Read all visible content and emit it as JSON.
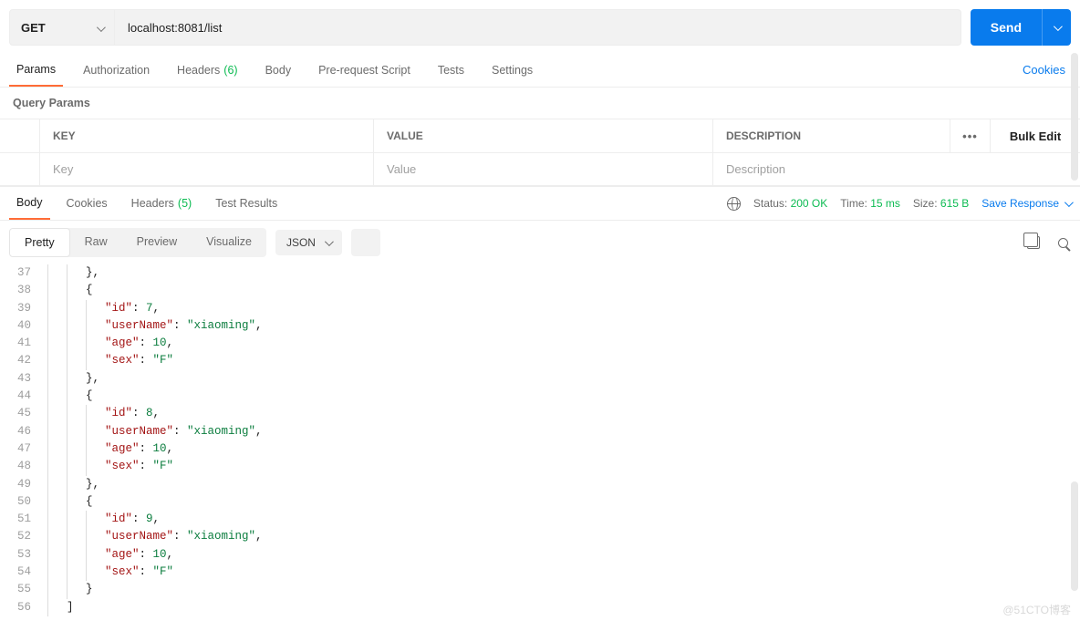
{
  "request": {
    "method": "GET",
    "url": "localhost:8081/list",
    "send_label": "Send"
  },
  "req_tabs": {
    "params": "Params",
    "auth": "Authorization",
    "headers": "Headers",
    "headers_count": "(6)",
    "body": "Body",
    "prereq": "Pre-request Script",
    "tests": "Tests",
    "settings": "Settings",
    "cookies": "Cookies"
  },
  "qp": {
    "title": "Query Params",
    "h_key": "KEY",
    "h_value": "VALUE",
    "h_desc": "DESCRIPTION",
    "bulk": "Bulk Edit",
    "p_key": "Key",
    "p_value": "Value",
    "p_desc": "Description"
  },
  "resp_tabs": {
    "body": "Body",
    "cookies": "Cookies",
    "headers": "Headers",
    "headers_count": "(5)",
    "tests": "Test Results"
  },
  "status": {
    "status_label": "Status:",
    "status_value": "200 OK",
    "time_label": "Time:",
    "time_value": "15 ms",
    "size_label": "Size:",
    "size_value": "615 B",
    "save": "Save Response"
  },
  "viewer": {
    "pretty": "Pretty",
    "raw": "Raw",
    "preview": "Preview",
    "visualize": "Visualize",
    "format": "JSON"
  },
  "code": {
    "start": 37,
    "lines": [
      {
        "d": 2,
        "t": [
          {
            "c": "p",
            "v": "},"
          }
        ]
      },
      {
        "d": 2,
        "t": [
          {
            "c": "p",
            "v": "{"
          }
        ]
      },
      {
        "d": 3,
        "t": [
          {
            "c": "k",
            "v": "\"id\""
          },
          {
            "c": "p",
            "v": ": "
          },
          {
            "c": "n",
            "v": "7"
          },
          {
            "c": "p",
            "v": ","
          }
        ]
      },
      {
        "d": 3,
        "t": [
          {
            "c": "k",
            "v": "\"userName\""
          },
          {
            "c": "p",
            "v": ": "
          },
          {
            "c": "s",
            "v": "\"xiaoming\""
          },
          {
            "c": "p",
            "v": ","
          }
        ]
      },
      {
        "d": 3,
        "t": [
          {
            "c": "k",
            "v": "\"age\""
          },
          {
            "c": "p",
            "v": ": "
          },
          {
            "c": "n",
            "v": "10"
          },
          {
            "c": "p",
            "v": ","
          }
        ]
      },
      {
        "d": 3,
        "t": [
          {
            "c": "k",
            "v": "\"sex\""
          },
          {
            "c": "p",
            "v": ": "
          },
          {
            "c": "s",
            "v": "\"F\""
          }
        ]
      },
      {
        "d": 2,
        "t": [
          {
            "c": "p",
            "v": "},"
          }
        ]
      },
      {
        "d": 2,
        "t": [
          {
            "c": "p",
            "v": "{"
          }
        ]
      },
      {
        "d": 3,
        "t": [
          {
            "c": "k",
            "v": "\"id\""
          },
          {
            "c": "p",
            "v": ": "
          },
          {
            "c": "n",
            "v": "8"
          },
          {
            "c": "p",
            "v": ","
          }
        ]
      },
      {
        "d": 3,
        "t": [
          {
            "c": "k",
            "v": "\"userName\""
          },
          {
            "c": "p",
            "v": ": "
          },
          {
            "c": "s",
            "v": "\"xiaoming\""
          },
          {
            "c": "p",
            "v": ","
          }
        ]
      },
      {
        "d": 3,
        "t": [
          {
            "c": "k",
            "v": "\"age\""
          },
          {
            "c": "p",
            "v": ": "
          },
          {
            "c": "n",
            "v": "10"
          },
          {
            "c": "p",
            "v": ","
          }
        ]
      },
      {
        "d": 3,
        "t": [
          {
            "c": "k",
            "v": "\"sex\""
          },
          {
            "c": "p",
            "v": ": "
          },
          {
            "c": "s",
            "v": "\"F\""
          }
        ]
      },
      {
        "d": 2,
        "t": [
          {
            "c": "p",
            "v": "},"
          }
        ]
      },
      {
        "d": 2,
        "t": [
          {
            "c": "p",
            "v": "{"
          }
        ]
      },
      {
        "d": 3,
        "t": [
          {
            "c": "k",
            "v": "\"id\""
          },
          {
            "c": "p",
            "v": ": "
          },
          {
            "c": "n",
            "v": "9"
          },
          {
            "c": "p",
            "v": ","
          }
        ]
      },
      {
        "d": 3,
        "t": [
          {
            "c": "k",
            "v": "\"userName\""
          },
          {
            "c": "p",
            "v": ": "
          },
          {
            "c": "s",
            "v": "\"xiaoming\""
          },
          {
            "c": "p",
            "v": ","
          }
        ]
      },
      {
        "d": 3,
        "t": [
          {
            "c": "k",
            "v": "\"age\""
          },
          {
            "c": "p",
            "v": ": "
          },
          {
            "c": "n",
            "v": "10"
          },
          {
            "c": "p",
            "v": ","
          }
        ]
      },
      {
        "d": 3,
        "t": [
          {
            "c": "k",
            "v": "\"sex\""
          },
          {
            "c": "p",
            "v": ": "
          },
          {
            "c": "s",
            "v": "\"F\""
          }
        ]
      },
      {
        "d": 2,
        "t": [
          {
            "c": "p",
            "v": "}"
          }
        ]
      },
      {
        "d": 1,
        "t": [
          {
            "c": "p",
            "v": "]"
          }
        ]
      }
    ]
  },
  "watermark": "@51CTO博客"
}
